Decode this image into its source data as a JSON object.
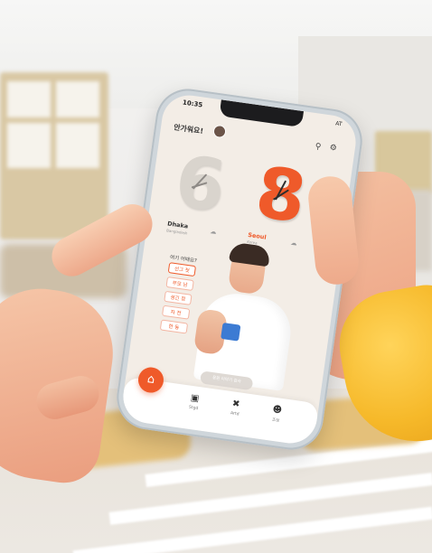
{
  "status": {
    "time": "10:35",
    "network": "AT"
  },
  "header": {
    "greeting": "안가워요!"
  },
  "clocks": [
    {
      "digit": "6",
      "city": "Dhaka",
      "sub": "Bangladesh"
    },
    {
      "digit": "8",
      "city": "Seoul",
      "sub": "Korea"
    }
  ],
  "quiz": {
    "question": "여기 어때요?",
    "options": [
      "선그 첫",
      "부모 남",
      "생긴 정",
      "자 전",
      "한 동"
    ]
  },
  "toast": {
    "text": "응원 이야기 감사"
  },
  "nav": {
    "items": [
      {
        "label": "Stgd"
      },
      {
        "label": "Artd"
      },
      {
        "label": "조보"
      }
    ]
  },
  "colors": {
    "accent": "#ef5a2a",
    "phone_frame": "#cfd6db",
    "screen_bg": "#f3ede6"
  },
  "icons": [
    "search-icon",
    "settings-icon",
    "home-icon",
    "chat-icon",
    "tools-icon",
    "user-icon"
  ]
}
